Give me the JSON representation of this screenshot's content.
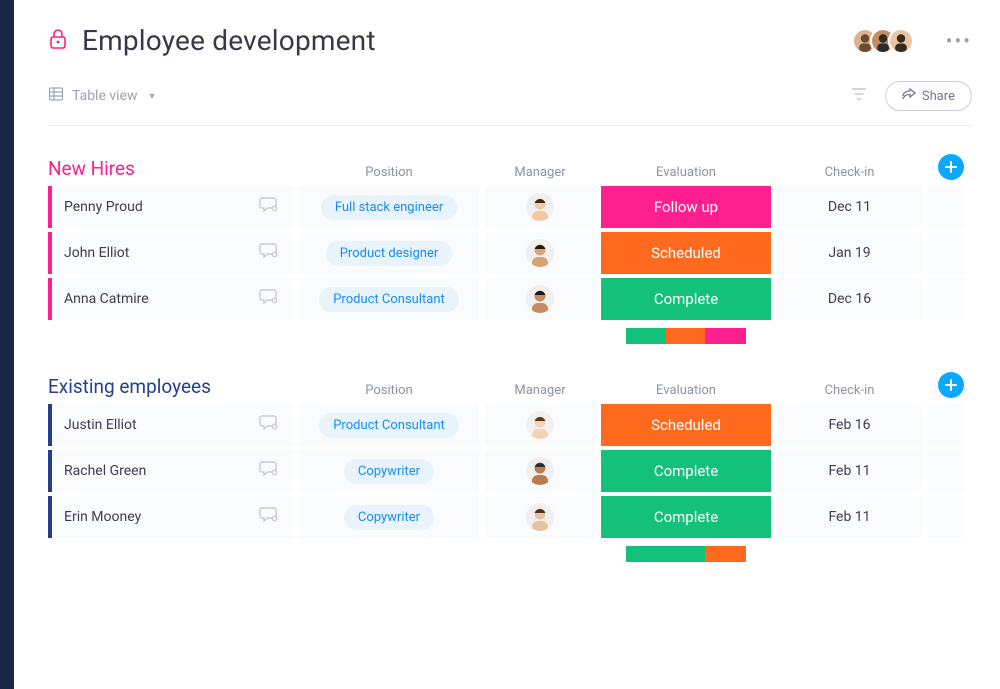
{
  "header": {
    "title": "Employee development",
    "more_label": "•••"
  },
  "toolbar": {
    "view_label": "Table view",
    "share_label": "Share"
  },
  "columns": {
    "position": "Position",
    "manager": "Manager",
    "evaluation": "Evaluation",
    "checkin": "Check-in"
  },
  "sections": [
    {
      "id": "new_hires",
      "title": "New Hires",
      "title_class": "new-hires-title",
      "bar_class": "bar-pink",
      "rows": [
        {
          "name": "Penny Proud",
          "position": "Full stack engineer",
          "evaluation": "Follow up",
          "eval_class": "eval-FollowUp",
          "checkin": "Dec 11"
        },
        {
          "name": "John Elliot",
          "position": "Product designer",
          "evaluation": "Scheduled",
          "eval_class": "eval-Scheduled",
          "checkin": "Jan 19"
        },
        {
          "name": "Anna Catmire",
          "position": "Product Consultant",
          "evaluation": "Complete",
          "eval_class": "eval-Complete",
          "checkin": "Dec 16"
        }
      ],
      "summary": [
        {
          "class": "seg-green",
          "pct": 33
        },
        {
          "class": "seg-orange",
          "pct": 33
        },
        {
          "class": "seg-pink",
          "pct": 34
        }
      ]
    },
    {
      "id": "existing",
      "title": "Existing employees",
      "title_class": "existing-title",
      "bar_class": "bar-blue",
      "rows": [
        {
          "name": "Justin Elliot",
          "position": "Product Consultant",
          "evaluation": "Scheduled",
          "eval_class": "eval-Scheduled",
          "checkin": "Feb 16"
        },
        {
          "name": "Rachel Green",
          "position": "Copywriter",
          "evaluation": "Complete",
          "eval_class": "eval-Complete",
          "checkin": "Feb 11"
        },
        {
          "name": "Erin Mooney",
          "position": "Copywriter",
          "evaluation": "Complete",
          "eval_class": "eval-Complete",
          "checkin": "Feb 11"
        }
      ],
      "summary": [
        {
          "class": "seg-green",
          "pct": 66
        },
        {
          "class": "seg-orange",
          "pct": 34
        }
      ]
    }
  ]
}
